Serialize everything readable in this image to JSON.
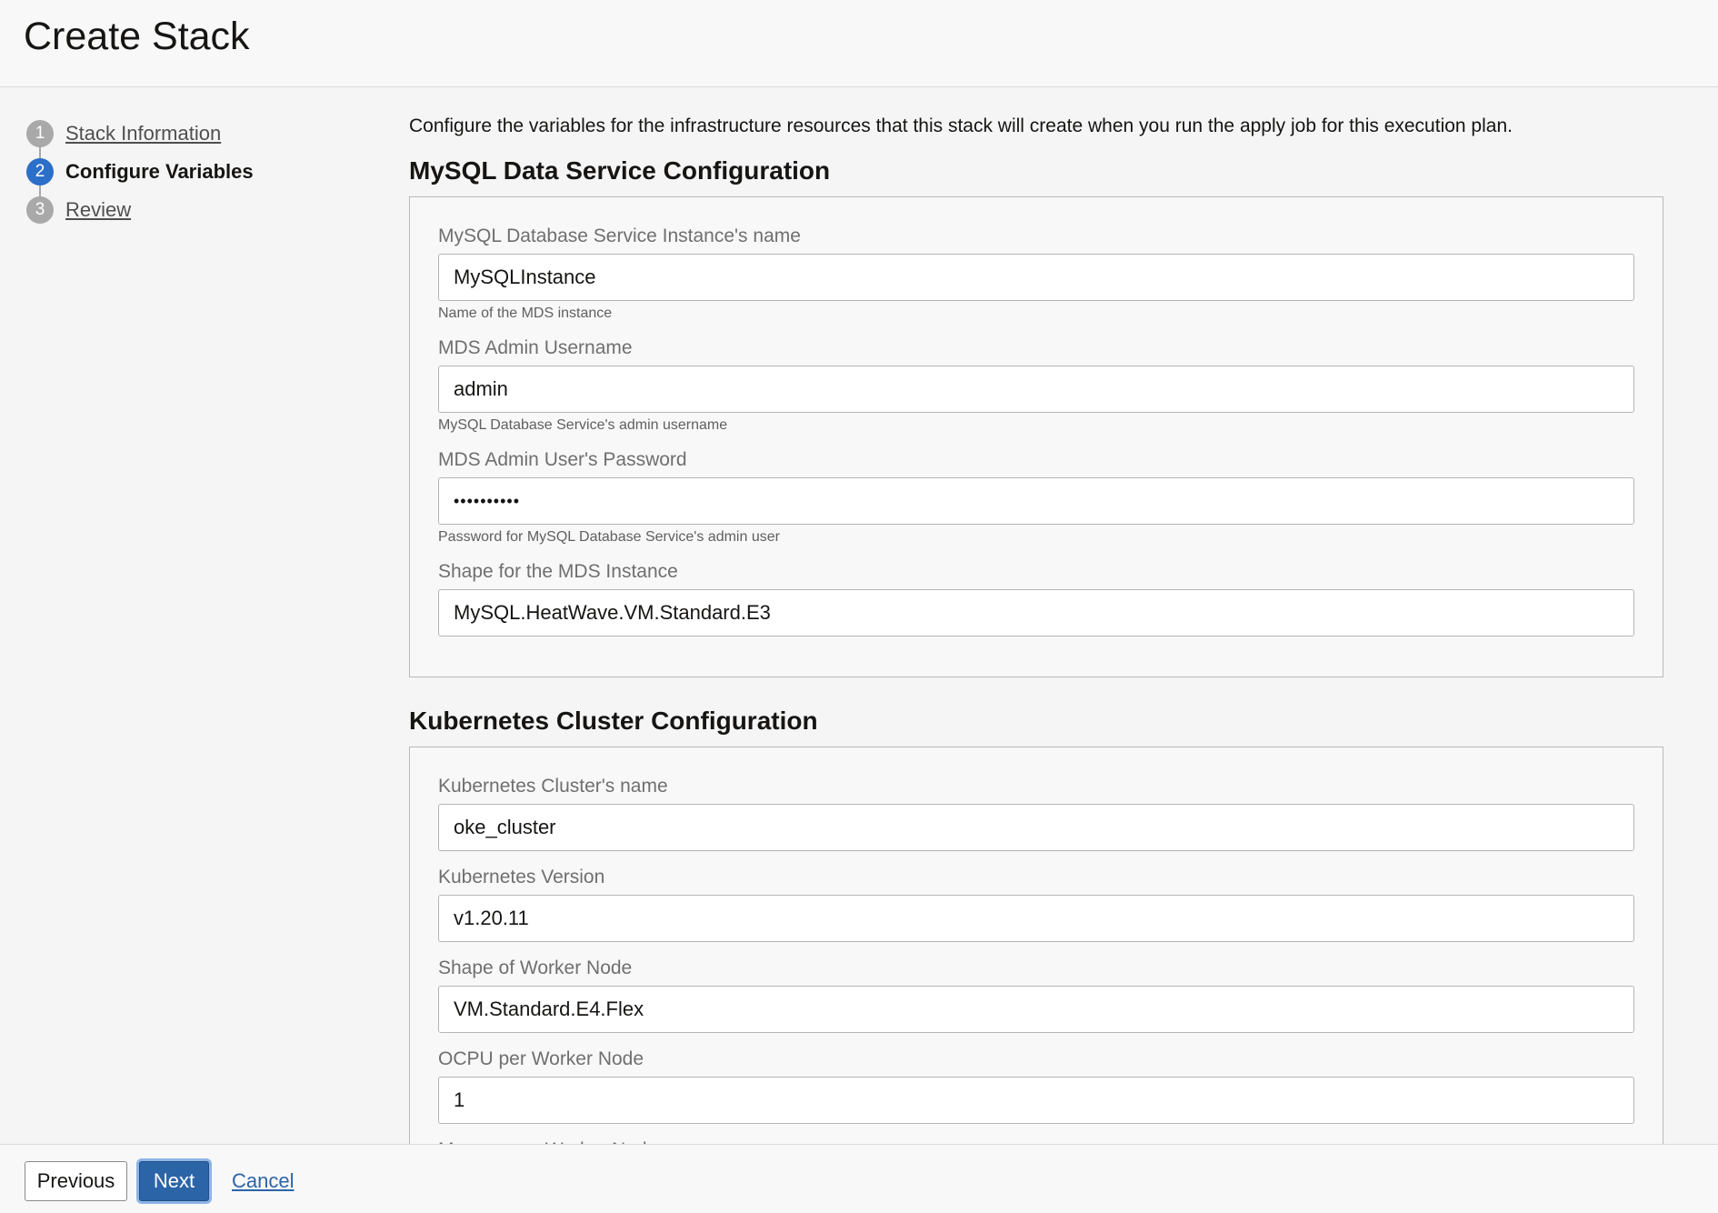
{
  "page": {
    "title": "Create Stack"
  },
  "steps": [
    {
      "number": "1",
      "label": "Stack Information",
      "state": "link"
    },
    {
      "number": "2",
      "label": "Configure Variables",
      "state": "active"
    },
    {
      "number": "3",
      "label": "Review",
      "state": "link"
    }
  ],
  "intro": "Configure the variables for the infrastructure resources that this stack will create when you run the apply job for this execution plan.",
  "mysql_section": {
    "title": "MySQL Data Service Configuration",
    "fields": [
      {
        "label": "MySQL Database Service Instance's name",
        "value": "MySQLInstance",
        "hint": "Name of the MDS instance"
      },
      {
        "label": "MDS Admin Username",
        "value": "admin",
        "hint": "MySQL Database Service's admin username"
      },
      {
        "label": "MDS Admin User's Password",
        "value": "••••••••••",
        "hint": "Password for MySQL Database Service's admin user"
      },
      {
        "label": "Shape for the MDS Instance",
        "value": "MySQL.HeatWave.VM.Standard.E3"
      }
    ]
  },
  "k8s_section": {
    "title": "Kubernetes Cluster Configuration",
    "fields": [
      {
        "label": "Kubernetes Cluster's name",
        "value": "oke_cluster"
      },
      {
        "label": "Kubernetes Version",
        "value": "v1.20.11"
      },
      {
        "label": "Shape of Worker Node",
        "value": "VM.Standard.E4.Flex"
      },
      {
        "label": "OCPU per Worker Node",
        "value": "1"
      },
      {
        "label": "Memory per Worker Node",
        "value": ""
      }
    ]
  },
  "footer": {
    "previous_label": "Previous",
    "next_label": "Next",
    "cancel_label": "Cancel"
  },
  "colors": {
    "accent": "#2c64a8",
    "active_step": "#2c6fc8",
    "inactive_step": "#a9a9a9"
  }
}
